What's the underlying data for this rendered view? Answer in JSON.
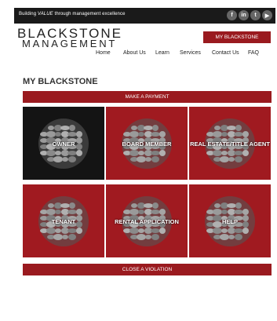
{
  "topbar": {
    "tagline_pre": "Building ",
    "tagline_em": "VALUE",
    "tagline_post": " through management excellence",
    "socials": [
      "f",
      "in",
      "t",
      "▶"
    ]
  },
  "logo": {
    "line1": "BLACKSTONE",
    "line2": "MANAGEMENT"
  },
  "header": {
    "my_button": "MY BLACKSTONE"
  },
  "nav": [
    "Home",
    "About Us",
    "Learn",
    "Services",
    "Contact Us",
    "FAQ"
  ],
  "main": {
    "title": "MY BLACKSTONE",
    "make_payment": "MAKE A PAYMENT",
    "tiles": [
      "OWNER",
      "BOARD MEMBER",
      "REAL ESTATE/TITLE AGENT",
      "TENANT",
      "RENTAL APPLICATION",
      "HELP"
    ],
    "close_violation": "CLOSE A VIOLATION"
  },
  "colors": {
    "brand_red": "#9a1a1f",
    "dark_tile": "#141414",
    "topbar": "#1a1a1a"
  }
}
